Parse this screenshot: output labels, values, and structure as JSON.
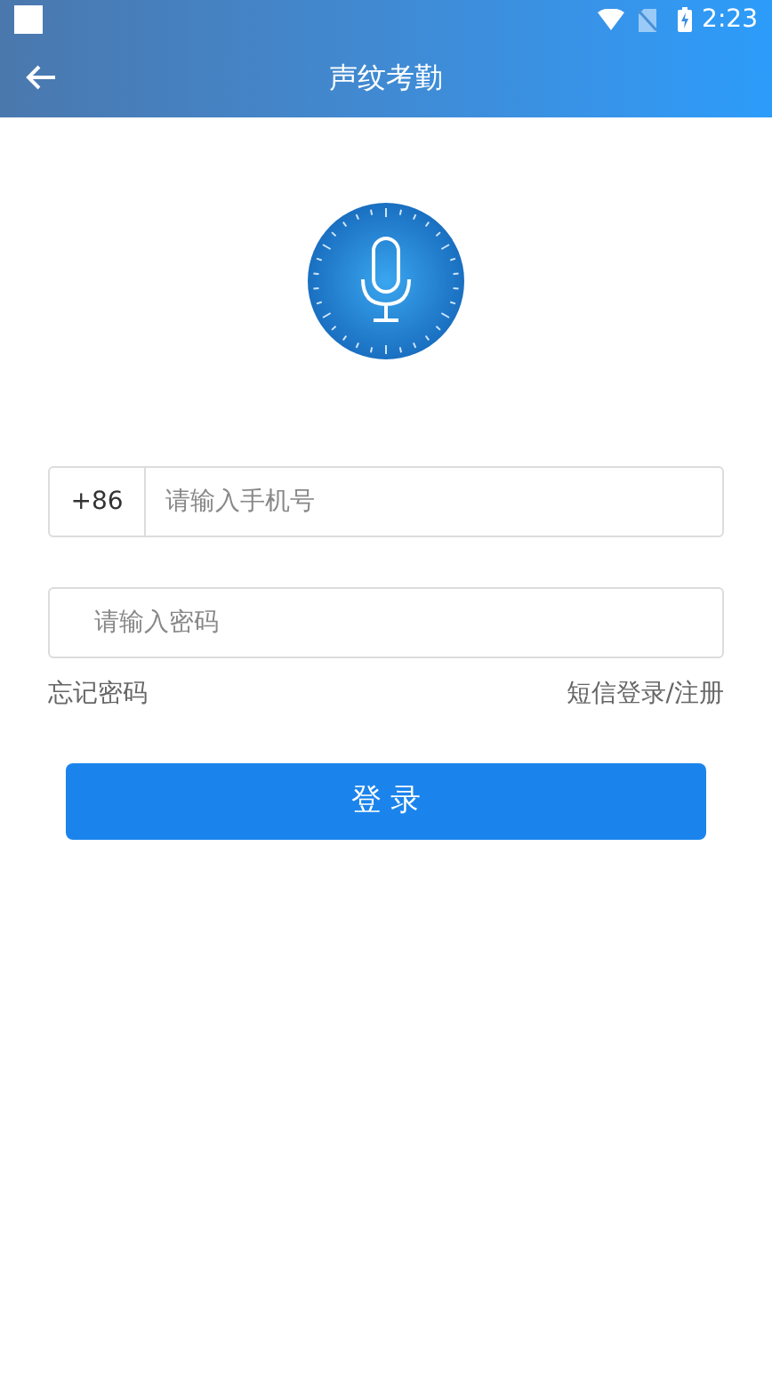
{
  "status_bar": {
    "time": "2:23"
  },
  "app_bar": {
    "title": "声纹考勤"
  },
  "phone_field": {
    "country_code": "+86",
    "placeholder": "请输入手机号"
  },
  "password_field": {
    "placeholder": "请输入密码"
  },
  "links": [
    {
      "label": "忘记密码"
    },
    {
      "label": "短信登录/注册"
    }
  ],
  "login_button": {
    "label": "登 录"
  }
}
